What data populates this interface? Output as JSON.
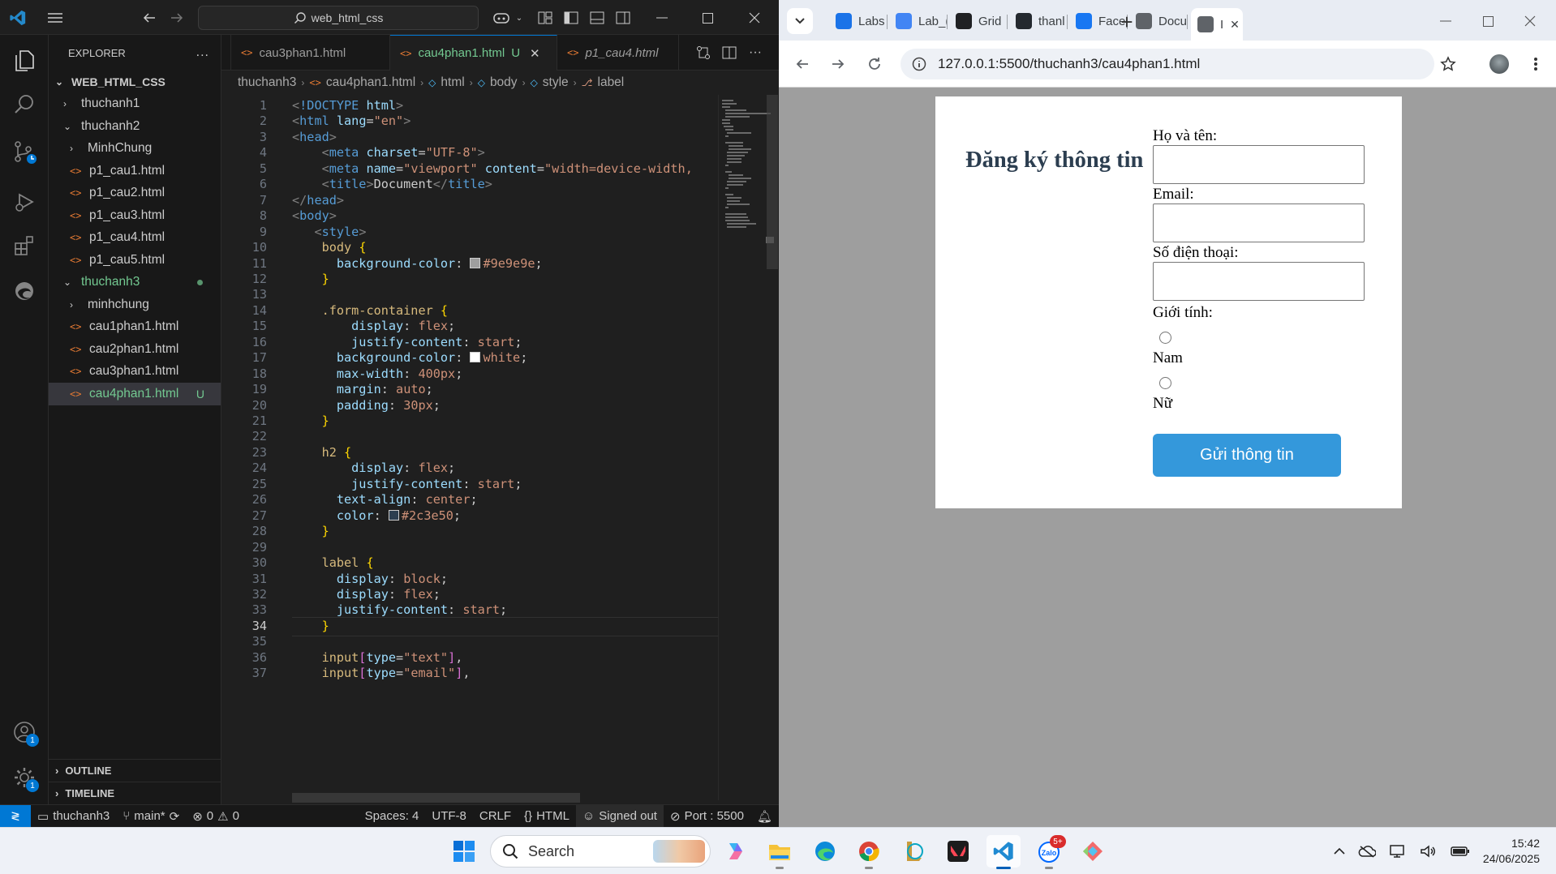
{
  "vscode": {
    "search_text": "web_html_css",
    "explorer": {
      "title": "EXPLORER",
      "more": "...",
      "root": "WEB_HTML_CSS",
      "items": [
        {
          "label": "thuchanh1",
          "kind": "folder-closed",
          "depth": 1
        },
        {
          "label": "thuchanh2",
          "kind": "folder-open",
          "depth": 1
        },
        {
          "label": "MinhChung",
          "kind": "folder-closed",
          "depth": 2
        },
        {
          "label": "p1_cau1.html",
          "kind": "file",
          "depth": 2
        },
        {
          "label": "p1_cau2.html",
          "kind": "file",
          "depth": 2
        },
        {
          "label": "p1_cau3.html",
          "kind": "file",
          "depth": 2
        },
        {
          "label": "p1_cau4.html",
          "kind": "file",
          "depth": 2
        },
        {
          "label": "p1_cau5.html",
          "kind": "file",
          "depth": 2
        },
        {
          "label": "thuchanh3",
          "kind": "folder-open",
          "depth": 1,
          "modified": true
        },
        {
          "label": "minhchung",
          "kind": "folder-closed",
          "depth": 2
        },
        {
          "label": "cau1phan1.html",
          "kind": "file",
          "depth": 2
        },
        {
          "label": "cau2phan1.html",
          "kind": "file",
          "depth": 2
        },
        {
          "label": "cau3phan1.html",
          "kind": "file",
          "depth": 2
        },
        {
          "label": "cau4phan1.html",
          "kind": "file",
          "depth": 2,
          "selected": true,
          "status": "U"
        }
      ],
      "outline": "OUTLINE",
      "timeline": "TIMELINE"
    },
    "tabs": [
      {
        "label": "cau3phan1.html"
      },
      {
        "label": "cau4phan1.html",
        "status": "U",
        "active": true,
        "close": "✕"
      },
      {
        "label": "p1_cau4.html",
        "italic": true
      }
    ],
    "breadcrumb": [
      "thuchanh3",
      "cau4phan1.html",
      "html",
      "body",
      "style",
      "label"
    ],
    "code_lines": [
      {
        "n": "1",
        "h": "<span class='g'>&lt;</span><span class='t'>!DOCTYPE</span> <span class='a'>html</span><span class='g'>&gt;</span>"
      },
      {
        "n": "2",
        "h": "<span class='g'>&lt;</span><span class='t'>html</span> <span class='a'>lang</span>=<span class='s'>\"en\"</span><span class='g'>&gt;</span>"
      },
      {
        "n": "3",
        "h": "<span class='g'>&lt;</span><span class='t'>head</span><span class='g'>&gt;</span>"
      },
      {
        "n": "4",
        "h": "    <span class='g'>&lt;</span><span class='t'>meta</span> <span class='a'>charset</span>=<span class='s'>\"UTF-8\"</span><span class='g'>&gt;</span>"
      },
      {
        "n": "5",
        "h": "    <span class='g'>&lt;</span><span class='t'>meta</span> <span class='a'>name</span>=<span class='s'>\"viewport\"</span> <span class='a'>content</span>=<span class='s'>\"width=device-width,</span>"
      },
      {
        "n": "6",
        "h": "    <span class='g'>&lt;</span><span class='t'>title</span><span class='g'>&gt;</span>Document<span class='g'>&lt;/</span><span class='t'>title</span><span class='g'>&gt;</span>"
      },
      {
        "n": "7",
        "h": "<span class='g'>&lt;/</span><span class='t'>head</span><span class='g'>&gt;</span>"
      },
      {
        "n": "8",
        "h": "<span class='g'>&lt;</span><span class='t'>body</span><span class='g'>&gt;</span>"
      },
      {
        "n": "9",
        "h": "   <span class='g'>&lt;</span><span class='t'>style</span><span class='g'>&gt;</span>"
      },
      {
        "n": "10",
        "h": "    <span class='y'>body</span> <span class='br'>{</span>"
      },
      {
        "n": "11",
        "h": "      <span class='a'>background-color</span>: <span class='sw' style='background:#9e9e9e'></span><span class='p'>#9e9e9e</span>;"
      },
      {
        "n": "12",
        "h": "    <span class='br'>}</span>"
      },
      {
        "n": "13",
        "h": ""
      },
      {
        "n": "14",
        "h": "    <span class='y'>.form-container</span> <span class='br'>{</span>"
      },
      {
        "n": "15",
        "h": "        <span class='a'>display</span>: <span class='p'>flex</span>;"
      },
      {
        "n": "16",
        "h": "        <span class='a'>justify-content</span>: <span class='p'>start</span>;"
      },
      {
        "n": "17",
        "h": "      <span class='a'>background-color</span>: <span class='sw' style='background:#ffffff'></span><span class='p'>white</span>;"
      },
      {
        "n": "18",
        "h": "      <span class='a'>max-width</span>: <span class='p'>400px</span>;"
      },
      {
        "n": "19",
        "h": "      <span class='a'>margin</span>: <span class='p'>auto</span>;"
      },
      {
        "n": "20",
        "h": "      <span class='a'>padding</span>: <span class='p'>30px</span>;"
      },
      {
        "n": "21",
        "h": "    <span class='br'>}</span>"
      },
      {
        "n": "22",
        "h": ""
      },
      {
        "n": "23",
        "h": "    <span class='y'>h2</span> <span class='br'>{</span>"
      },
      {
        "n": "24",
        "h": "        <span class='a'>display</span>: <span class='p'>flex</span>;"
      },
      {
        "n": "25",
        "h": "        <span class='a'>justify-content</span>: <span class='p'>start</span>;"
      },
      {
        "n": "26",
        "h": "      <span class='a'>text-align</span>: <span class='p'>center</span>;"
      },
      {
        "n": "27",
        "h": "      <span class='a'>color</span>: <span class='sw' style='background:#2c3e50'></span><span class='p'>#2c3e50</span>;"
      },
      {
        "n": "28",
        "h": "    <span class='br'>}</span>"
      },
      {
        "n": "29",
        "h": ""
      },
      {
        "n": "30",
        "h": "    <span class='y'>label</span> <span class='br'>{</span>"
      },
      {
        "n": "31",
        "h": "      <span class='a'>display</span>: <span class='p'>block</span>;"
      },
      {
        "n": "32",
        "h": "      <span class='a'>display</span>: <span class='p'>flex</span>;"
      },
      {
        "n": "33",
        "h": "      <span class='a'>justify-content</span>: <span class='p'>start</span>;"
      },
      {
        "n": "34",
        "h": "    <span class='br'>}</span>",
        "current": true
      },
      {
        "n": "35",
        "h": ""
      },
      {
        "n": "36",
        "h": "    <span class='y'>input</span><span class='pu'>[</span><span class='a'>type</span>=<span class='s'>\"text\"</span><span class='pu'>]</span>,"
      },
      {
        "n": "37",
        "h": "    <span class='y'>input</span><span class='pu'>[</span><span class='a'>type</span>=<span class='s'>\"email\"</span><span class='pu'>]</span>,"
      }
    ],
    "status": {
      "folder": "thuchanh3",
      "branch": "main*",
      "errors": "0",
      "warnings": "0",
      "spaces": "Spaces: 4",
      "encoding": "UTF-8",
      "eol": "CRLF",
      "language": "HTML",
      "account": "Signed out",
      "port": "Port : 5500"
    },
    "badges": {
      "accounts": "1",
      "settings": "1"
    }
  },
  "chrome": {
    "tabs": [
      {
        "label": "Labs",
        "favicon": "drive-icon",
        "color": "#1a73e8"
      },
      {
        "label": "Lab_(",
        "favicon": "docs-icon",
        "color": "#4285f4"
      },
      {
        "label": "Grid",
        "favicon": "openai-icon",
        "color": "#202124"
      },
      {
        "label": "thanl",
        "favicon": "github-icon",
        "color": "#24292f"
      },
      {
        "label": "Face",
        "favicon": "facebook-icon",
        "color": "#1877f2"
      },
      {
        "label": "Docu",
        "favicon": "globe-icon",
        "color": "#5f6368"
      },
      {
        "label": "I",
        "favicon": "globe-icon",
        "color": "#5f6368",
        "active": true,
        "close": "✕"
      }
    ],
    "new_tab": "+",
    "url": "127.0.0.1:5500/thuchanh3/cau4phan1.html",
    "page": {
      "heading": "Đăng ký thông tin",
      "name_label": "Họ và tên:",
      "email_label": "Email:",
      "phone_label": "Số điện thoại:",
      "gender_label": "Giới tính:",
      "male": "Nam",
      "female": "Nữ",
      "submit": "Gửi thông tin"
    }
  },
  "taskbar": {
    "search": "Search",
    "time": "15:42",
    "date": "24/06/2025",
    "zalo_badge": "5+"
  }
}
